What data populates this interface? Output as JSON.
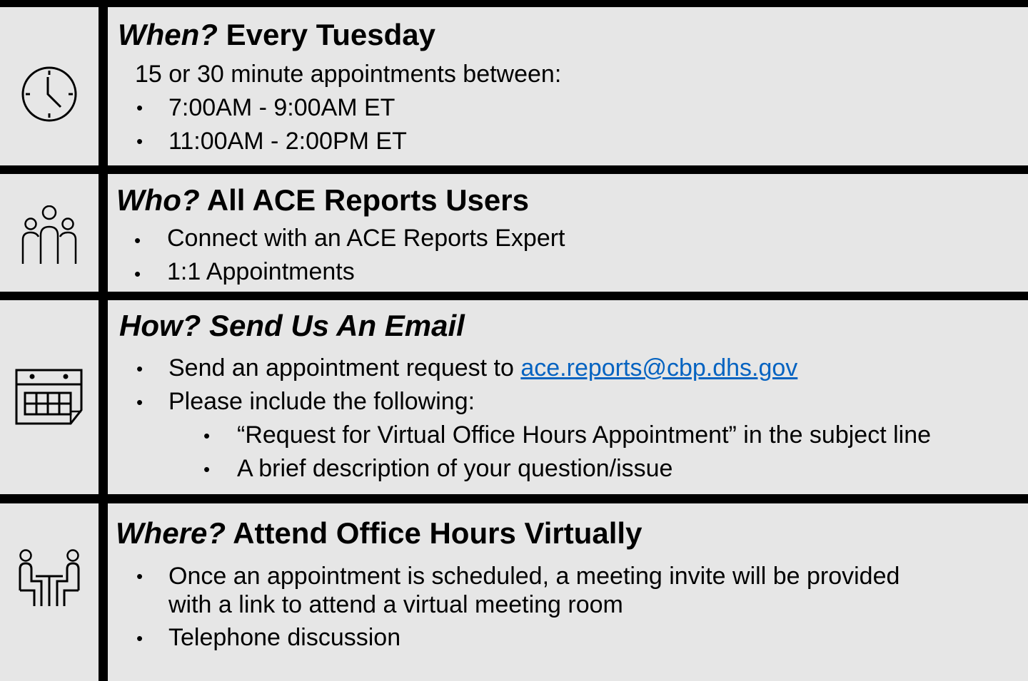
{
  "when": {
    "question": "When?",
    "heading": "Every Tuesday",
    "intro": "15 or 30 minute appointments between:",
    "items": [
      "7:00AM - 9:00AM ET",
      "11:00AM - 2:00PM ET"
    ],
    "icon": "clock-icon"
  },
  "who": {
    "question": "Who?",
    "heading": "All ACE Reports Users",
    "items": [
      "Connect with an ACE Reports Expert",
      "1:1 Appointments"
    ],
    "icon": "people-group-icon"
  },
  "how": {
    "question": "How?",
    "heading": "Send Us An Email",
    "item1_prefix": "Send an appointment request to ",
    "email": "ace.reports@cbp.dhs.gov",
    "item2": "Please include the following:",
    "subitems": [
      "“Request for Virtual Office Hours Appointment” in the subject line",
      "A brief description of your question/issue"
    ],
    "icon": "calendar-icon",
    "link_color": "#0563c1"
  },
  "where": {
    "question": "Where?",
    "heading": "Attend Office Hours Virtually",
    "item1_line1": "Once an appointment is scheduled, a meeting invite will be provided",
    "item1_line2": "with a link to attend a virtual meeting room",
    "item2": "Telephone discussion",
    "icon": "meeting-icon"
  },
  "bullet_char": "•"
}
